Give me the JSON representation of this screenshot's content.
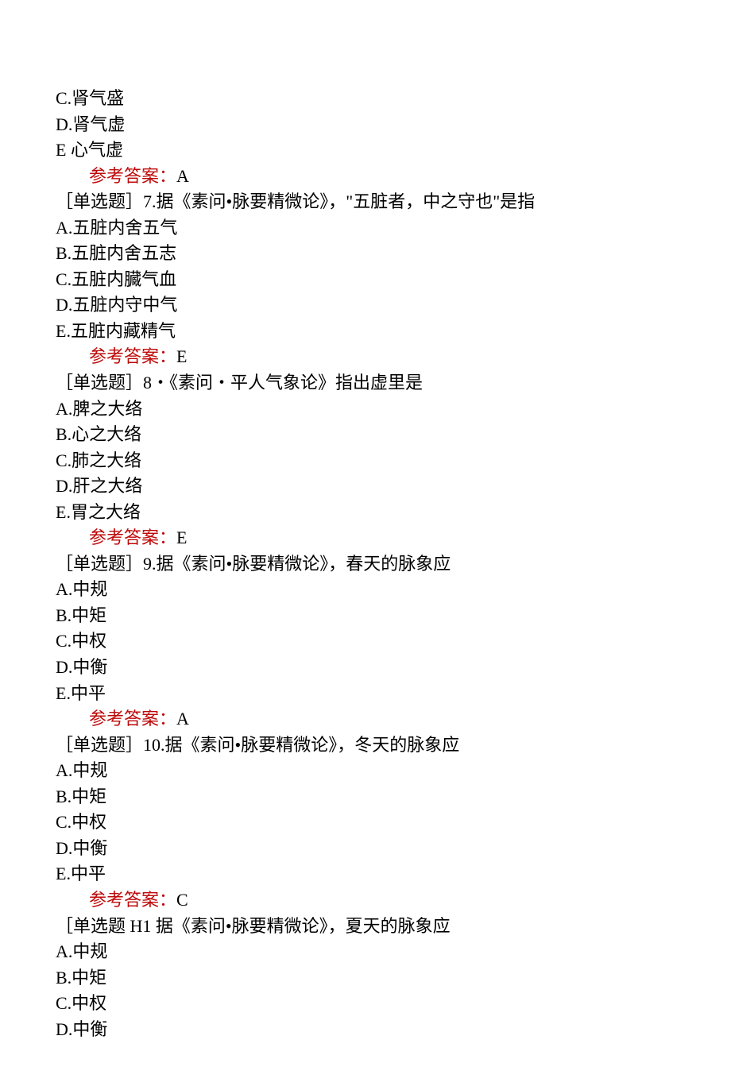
{
  "labels": {
    "answer_prefix": "参考答案：",
    "single_choice_open": "［单选题］",
    "single_choice_open_h1": "［单选题 H1 "
  },
  "block0": {
    "optC": "C.肾气盛",
    "optD": "D.肾气虚",
    "optE": "E 心气虚",
    "answer": "A"
  },
  "q7": {
    "stem": "7.据《素问•脉要精微论》，\"五脏者，中之守也\"是指",
    "optA": "A.五脏内舍五气",
    "optB": "B.五脏内舍五志",
    "optC": "C.五脏内臓气血",
    "optD": "D.五脏内守中气",
    "optE": "E.五脏内藏精气",
    "answer": "E"
  },
  "q8": {
    "stem": "8・《素问・平人气象论》指出虚里是",
    "optA": "A.脾之大络",
    "optB": "B.心之大络",
    "optC": "C.肺之大络",
    "optD": "D.肝之大络",
    "optE": "E.胃之大络",
    "answer": "E"
  },
  "q9": {
    "stem": "9.据《素问•脉要精微论》，春天的脉象应",
    "optA": "A.中规",
    "optB": "B.中矩",
    "optC": "C.中权",
    "optD": "D.中衡",
    "optE": "E.中平",
    "answer": "A"
  },
  "q10": {
    "stem": "10.据《素问•脉要精微论》，冬天的脉象应",
    "optA": "A.中规",
    "optB": "B.中矩",
    "optC": "C.中权",
    "optD": "D.中衡",
    "optE": "E.中平",
    "answer": "C"
  },
  "q11": {
    "stem": "据《素问•脉要精微论》，夏天的脉象应",
    "optA": "A.中规",
    "optB": "B.中矩",
    "optC": "C.中权",
    "optD": "D.中衡"
  }
}
